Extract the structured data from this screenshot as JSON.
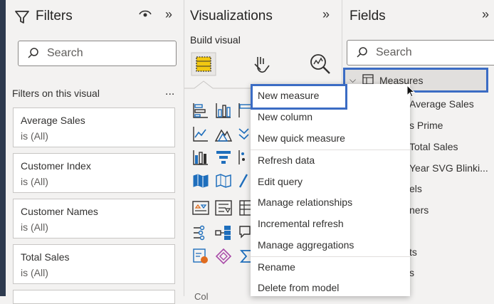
{
  "filters": {
    "title": "Filters",
    "search_placeholder": "Search",
    "section_label": "Filters on this visual",
    "more": "...",
    "cards": [
      {
        "name": "Average Sales",
        "state": "is (All)"
      },
      {
        "name": "Customer Index",
        "state": "is (All)"
      },
      {
        "name": "Customer Names",
        "state": "is (All)"
      },
      {
        "name": "Total Sales",
        "state": "is (All)"
      }
    ]
  },
  "visualizations": {
    "title": "Visualizations",
    "build_visual": "Build visual",
    "bottom_label": "Col"
  },
  "fields": {
    "title": "Fields",
    "search_placeholder": "Search",
    "table_name": "Measures",
    "items": [
      "Average Sales",
      "s Prime",
      "Total Sales",
      "Year SVG Blinki...",
      "els",
      "ners",
      "ts",
      "s"
    ]
  },
  "context_menu": {
    "items": [
      "New measure",
      "New column",
      "New quick measure",
      "Refresh data",
      "Edit query",
      "Manage relationships",
      "Incremental refresh",
      "Manage aggregations",
      "Rename",
      "Delete from model"
    ]
  },
  "colors": {
    "highlight": "#3b6cc4",
    "accent_yellow": "#f2c811"
  }
}
